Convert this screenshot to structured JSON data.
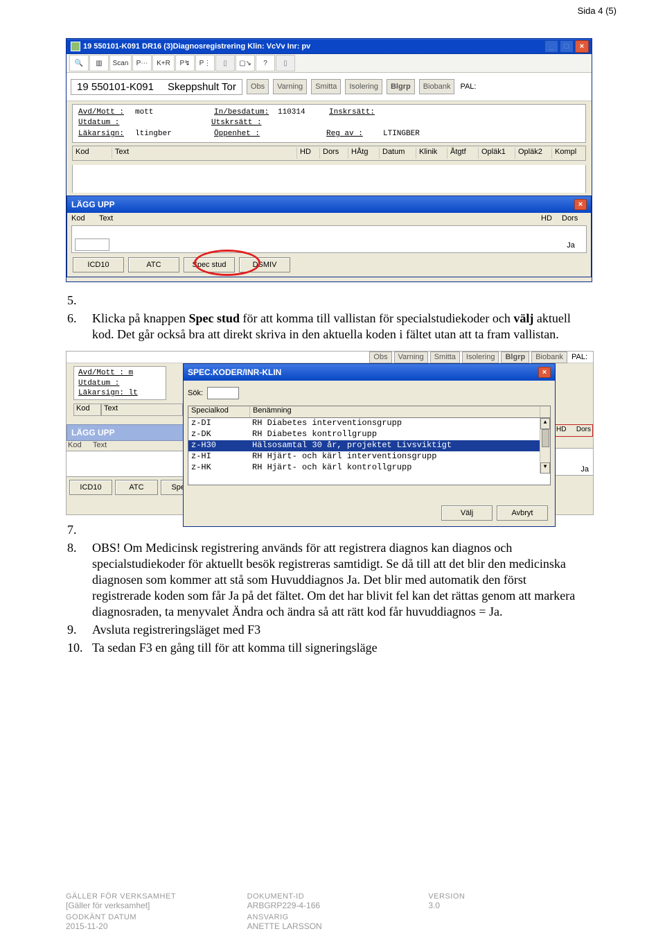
{
  "page_header": {
    "page_indicator": "Sida 4 (5)"
  },
  "shot1": {
    "title": "19 550101-K091   DR16 (3)Diagnosregistrering            Klin: VcVv  Inr: pv",
    "winbtns": {
      "min": "_",
      "max": "□",
      "close": "×"
    },
    "tool_labels": [
      "Scan",
      "K+R"
    ],
    "patient": {
      "id": "19 550101-K091",
      "name": "Skeppshult Tor"
    },
    "pt_buttons": [
      "Obs",
      "Varning",
      "Smitta",
      "Isolering"
    ],
    "pt_bold_btn": "Blgrp",
    "pt_button_last": "Biobank",
    "pal_label": "PAL:",
    "info": {
      "r1a": "Avd/Mott :",
      "r1av": "mott",
      "r1b": "In/besdatum:",
      "r1bv": "110314",
      "r1c": "Inskrsätt:",
      "r2a": "Utdatum  :",
      "r2b": "Utskrsätt  :",
      "r3a": "Läkarsign:",
      "r3av": "ltingber",
      "r3b": "Öppenhet   :",
      "r3c": "Reg av   :",
      "r3cv": "LTINGBER"
    },
    "grid_cols": [
      "Kod",
      "Text",
      "HD",
      "Dors",
      "HÅtg",
      "Datum",
      "Klinik",
      "Åtgtf",
      "Opläk1",
      "Opläk2",
      "Kompl"
    ],
    "dialog_title": "LÄGG UPP",
    "dlg_cols": {
      "kod": "Kod",
      "text": "Text",
      "hd": "HD",
      "dors": "Dors"
    },
    "ja": "Ja",
    "btns": [
      "ICD10",
      "ATC",
      "Spec stud",
      "DSMIV"
    ]
  },
  "doc_list": {
    "i5_num": "5.",
    "i5_text": "",
    "i6_num": "6.",
    "i6_text": "Klicka på knappen Spec stud för att komma till vallistan för specialstudiekoder och välj aktuell kod. Det går också bra att direkt skriva in den aktuella koden i fältet utan att ta fram vallistan.",
    "i7_num": "7.",
    "i7_text": "",
    "i8_num": "8.",
    "i8_text": "OBS! Om Medicinsk registrering används för att registrera diagnos kan diagnos och specialstudiekoder för aktuellt besök registreras samtidigt. Se då till att det blir den medicinska diagnosen som kommer att stå som Huvuddiagnos Ja. Det blir med automatik den först registrerade koden som får Ja på det fältet. Om det har blivit fel kan det rättas genom att markera diagnosraden, ta menyvalet Ändra och ändra så att rätt kod får huvuddiagnos = Ja.",
    "i9_num": "9.",
    "i9_text": "Avsluta registreringsläget med F3",
    "i10_num": "10.",
    "i10_text": "Ta sedan F3 en gång till för att komma till signeringsläge"
  },
  "shot2": {
    "top_btns": [
      "Obs",
      "Varning",
      "Smitta",
      "Isolering"
    ],
    "top_bold": "Blgrp",
    "top_last": "Biobank",
    "pal": "PAL:",
    "left_info": {
      "a": "Avd/Mott : m",
      "b": "Utdatum  :",
      "c": "Läkarsign: lt"
    },
    "grid_left": [
      "Kod",
      "Text"
    ],
    "sub_title": "SPEC.KODER/INR-KLIN",
    "sok_label": "Sök:",
    "cols": {
      "c1": "Specialkod",
      "c2": "Benämning"
    },
    "rows": [
      {
        "code": "z-DI",
        "name": "RH Diabetes interventionsgrupp"
      },
      {
        "code": "z-DK",
        "name": "RH Diabetes kontrollgrupp"
      },
      {
        "code": "z-H30",
        "name": "Hälsosamtal 30 år, projektet Livsviktigt"
      },
      {
        "code": "z-HI",
        "name": "RH Hjärt- och kärl interventionsgrupp"
      },
      {
        "code": "z-HK",
        "name": "RH Hjärt- och kärl kontrollgrupp"
      }
    ],
    "selected_index": 2,
    "faded_title": "LÄGG UPP",
    "faded_labels": {
      "kod": "Kod",
      "text": "Text",
      "hd": "HD",
      "dors": "Dors"
    },
    "ja": "Ja",
    "left_btns": [
      "ICD10",
      "ATC",
      "Spec"
    ],
    "bot_btns": [
      "Välj",
      "Avbryt"
    ],
    "close_x": "×"
  },
  "footer": {
    "c1l1": "GÄLLER FÖR VERKSAMHET",
    "c1v1": "[Gäller för verksamhet]",
    "c1l2": "GODKÄNT DATUM",
    "c1v2": "2015-11-20",
    "c2l1": "DOKUMENT-ID",
    "c2v1": "ARBGRP229-4-166",
    "c2l2": "ANSVARIG",
    "c2v2": "ANETTE LARSSON",
    "c3l1": "VERSION",
    "c3v1": "3.0"
  }
}
